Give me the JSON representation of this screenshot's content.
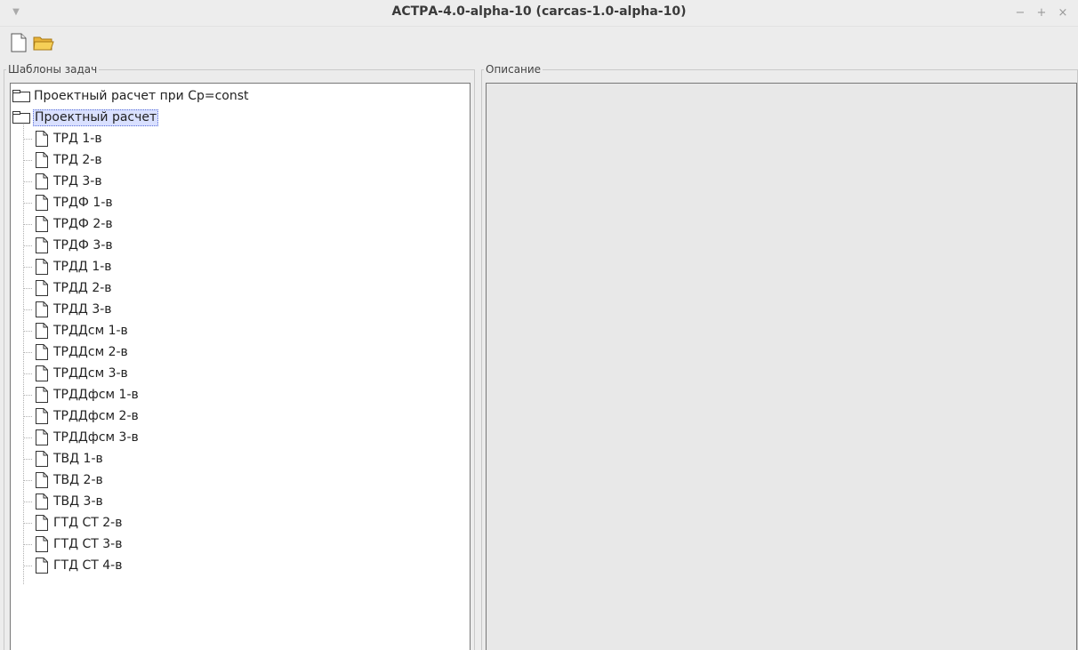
{
  "window": {
    "title": "АСТРА-4.0-alpha-10 (carcas-1.0-alpha-10)",
    "controls": [
      "−",
      "+",
      "×"
    ]
  },
  "toolbar": {
    "new_icon": "new-file-icon",
    "open_icon": "open-folder-icon"
  },
  "panels": {
    "tasks_legend": "Шаблоны задач",
    "description_legend": "Описание"
  },
  "tree": {
    "folders": [
      {
        "label": "Проектный расчет при Cp=const",
        "selected": false
      },
      {
        "label": "Проектный расчет",
        "selected": true
      }
    ],
    "children": [
      "ТРД 1-в",
      "ТРД 2-в",
      "ТРД 3-в",
      "ТРДФ 1-в",
      "ТРДФ 2-в",
      "ТРДФ 3-в",
      "ТРДД 1-в",
      "ТРДД 2-в",
      "ТРДД 3-в",
      "ТРДДсм 1-в",
      "ТРДДсм 2-в",
      "ТРДДсм 3-в",
      "ТРДДфсм 1-в",
      "ТРДДфсм 2-в",
      "ТРДДфсм 3-в",
      "ТВД 1-в",
      "ТВД 2-в",
      "ТВД 3-в",
      "ГТД СТ 2-в",
      "ГТД СТ 3-в",
      "ГТД СТ 4-в"
    ]
  }
}
